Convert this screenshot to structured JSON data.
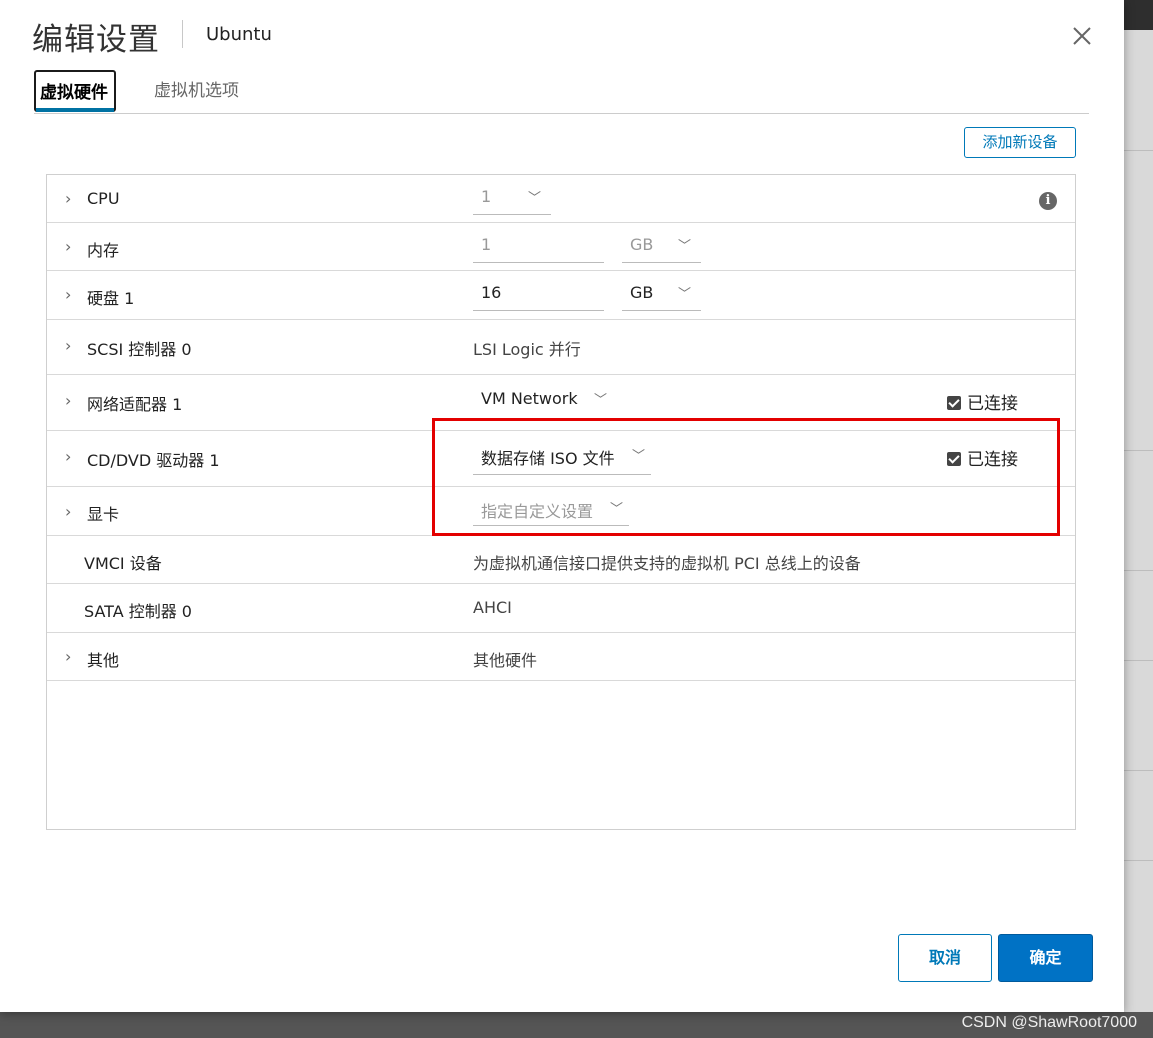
{
  "dialog": {
    "title": "编辑设置",
    "subtitle": "Ubuntu"
  },
  "tabs": [
    {
      "label": "虚拟硬件",
      "active": true
    },
    {
      "label": "虚拟机选项",
      "active": false
    }
  ],
  "toolbar": {
    "add_device_label": "添加新设备"
  },
  "hardware": {
    "cpu": {
      "label": "CPU",
      "value": "1"
    },
    "memory": {
      "label": "内存",
      "value": "1",
      "unit": "GB"
    },
    "disk": {
      "label": "硬盘 1",
      "value": "16",
      "unit": "GB"
    },
    "scsi": {
      "label": "SCSI 控制器 0",
      "value": "LSI Logic 并行"
    },
    "network": {
      "label": "网络适配器 1",
      "value": "VM Network",
      "connected_label": "已连接",
      "connected": true
    },
    "cddvd": {
      "label": "CD/DVD 驱动器 1",
      "value": "数据存储 ISO 文件",
      "connected_label": "已连接",
      "connected": true
    },
    "video": {
      "label": "显卡",
      "value": "指定自定义设置"
    },
    "vmci": {
      "label": "VMCI 设备",
      "value": "为虚拟机通信接口提供支持的虚拟机 PCI 总线上的设备"
    },
    "sata": {
      "label": "SATA 控制器 0",
      "value": "AHCI"
    },
    "other": {
      "label": "其他",
      "value": "其他硬件"
    }
  },
  "footer": {
    "cancel_label": "取消",
    "ok_label": "确定"
  },
  "watermark": "CSDN @ShawRoot7000",
  "colors": {
    "accent": "#0079b8",
    "primary_button": "#0072c5",
    "highlight": "#e30000"
  }
}
